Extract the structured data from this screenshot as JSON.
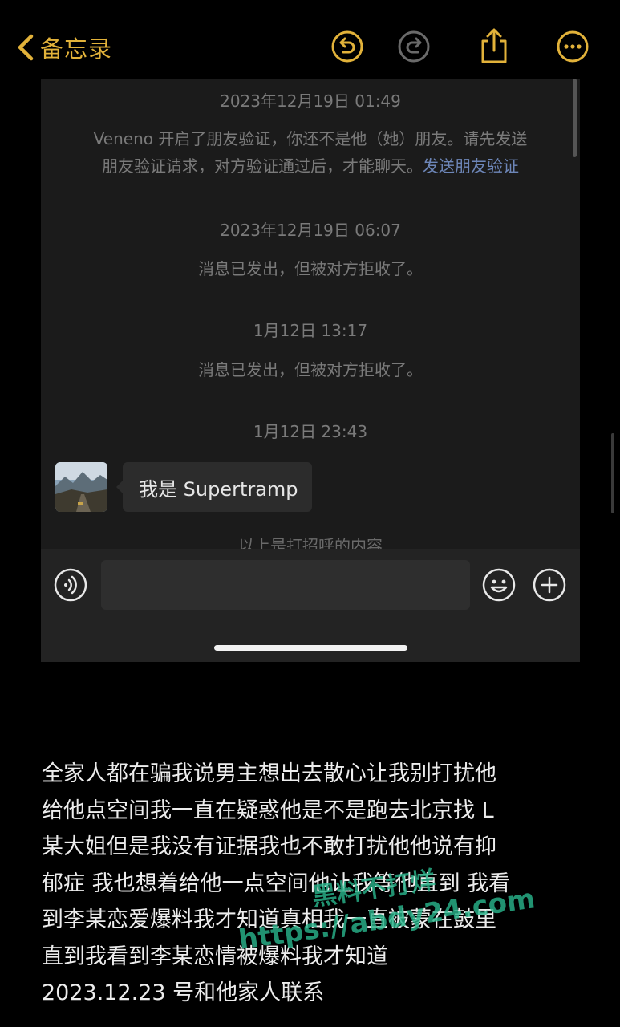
{
  "nav": {
    "back_label": "备忘录"
  },
  "chat": {
    "ts1": "2023年12月19日 01:49",
    "sys1_line1": "Veneno 开启了朋友验证，你还不是他（她）朋友。请先发送",
    "sys1_line2": "朋友验证请求，对方验证通过后，才能聊天。",
    "sys1_link": "发送朋友验证",
    "ts2": "2023年12月19日 06:07",
    "sys2": "消息已发出，但被对方拒收了。",
    "ts3": "1月12日 13:17",
    "sys3": "消息已发出，但被对方拒收了。",
    "ts4": "1月12日 23:43",
    "bubble": "我是 Supertramp",
    "greeting": "以上是打招呼的内容"
  },
  "note": {
    "lines": [
      "全家人都在骗我说男主想出去散心让我别打扰他",
      "给他点空间我一直在疑惑他是不是跑去北京找 L",
      "某大姐但是我没有证据我也不敢打扰他他说有抑",
      "郁症 我也想着给他一点空间他让我等他直到 我看",
      "到李某恋爱爆料我才知道真相我一直被蒙在鼓里",
      "直到我看到李某恋情被爆料我才知道",
      "2023.12.23 号和他家人联系"
    ]
  },
  "watermark": {
    "line1": "黑料不打烊",
    "line2": "https://abdy24.com"
  },
  "colors": {
    "accent": "#e2b23a",
    "link": "#6d86b8",
    "watermark": "#29b38a"
  },
  "icons": [
    "chevron-left-icon",
    "undo-icon",
    "redo-icon",
    "share-icon",
    "more-icon",
    "voice-icon",
    "emoji-icon",
    "plus-icon"
  ]
}
